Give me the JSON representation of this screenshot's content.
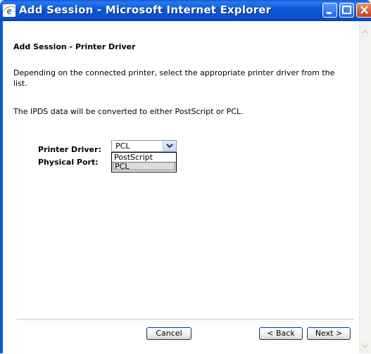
{
  "window": {
    "title": "Add Session - Microsoft Internet Explorer",
    "icon": "ie-icon",
    "controls": [
      "minimize-icon",
      "maximize-icon",
      "close-icon"
    ]
  },
  "page": {
    "heading": "Add Session - Printer Driver",
    "instructions": "Depending on the connected printer, select the appropriate printer driver from the list.",
    "note": "The IPDS data will be converted to either PostScript or PCL."
  },
  "form": {
    "printer_driver_label": "Printer Driver:",
    "physical_port_label": "Physical Port:",
    "driver_selected": "PCL",
    "driver_options": [
      "PostScript",
      "PCL"
    ]
  },
  "buttons": {
    "cancel": "Cancel",
    "back": "< Back",
    "next": "Next >"
  },
  "colors": {
    "titlebar": "#0b58d6",
    "highlight_option": "#dcdcdc"
  }
}
